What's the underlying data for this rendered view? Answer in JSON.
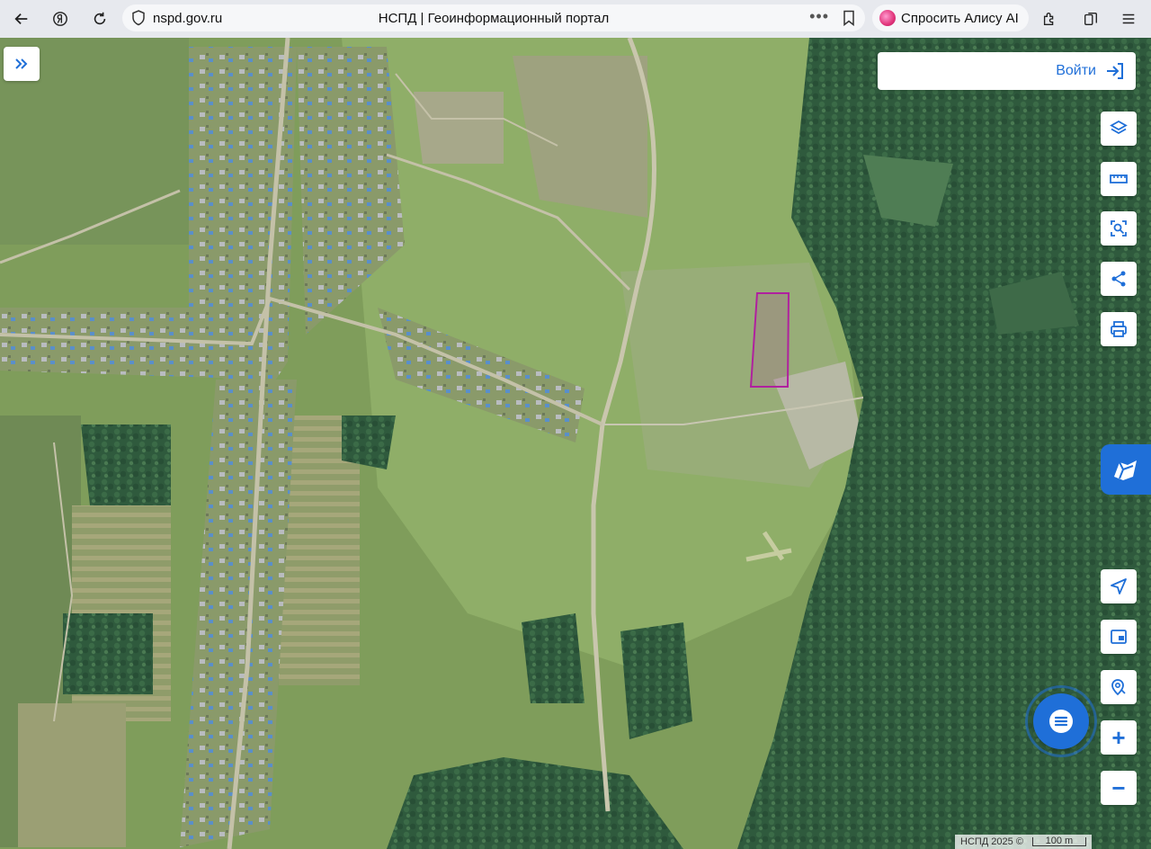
{
  "browser": {
    "url": "nspd.gov.ru",
    "page_title": "НСПД | Геоинформационный портал",
    "alice_label": "Спросить Алису AI",
    "menu_dots": "•••"
  },
  "map": {
    "login_label": "Войти",
    "zoom_in_label": "+",
    "zoom_out_label": "−",
    "copyright": "НСПД 2025 ©",
    "scale_label": "100 m",
    "tools": [
      "layers-icon",
      "ruler-icon",
      "select-area-icon",
      "share-icon",
      "print-icon",
      "locate-icon",
      "minimap-icon",
      "search-location-icon"
    ],
    "colors": {
      "accent": "#1f6fd8",
      "parcel_outline": "#b0209f"
    }
  }
}
